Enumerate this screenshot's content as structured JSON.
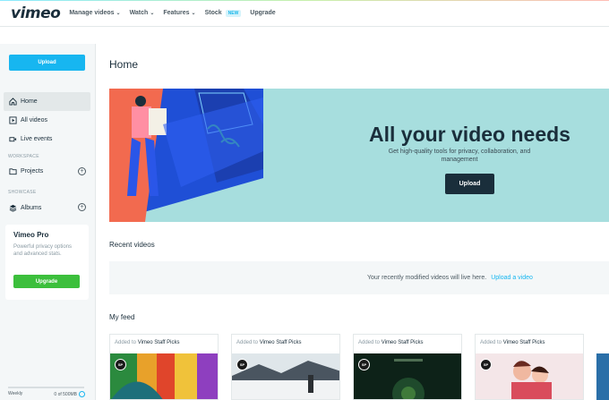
{
  "nav": {
    "logo": "vimeo",
    "items": [
      {
        "label": "Manage videos",
        "has_caret": true
      },
      {
        "label": "Watch",
        "has_caret": true
      },
      {
        "label": "Features",
        "has_caret": true
      },
      {
        "label": "Stock",
        "badge": "NEW"
      },
      {
        "label": "Upgrade"
      }
    ]
  },
  "sidebar": {
    "upload_label": "Upload",
    "items": [
      {
        "label": "Home",
        "icon": "home-icon"
      },
      {
        "label": "All videos",
        "icon": "video-library-icon"
      },
      {
        "label": "Live events",
        "icon": "camera-icon"
      },
      {
        "label": "Projects",
        "icon": "folder-icon"
      },
      {
        "label": "Albums",
        "icon": "stack-icon"
      }
    ],
    "workspace_label": "WORKSPACE",
    "showcase_label": "SHOWCASE",
    "pro": {
      "title": "Vimeo Pro",
      "description": "Powerful privacy options and advanced stats.",
      "button": "Upgrade"
    },
    "storage": {
      "period": "Weekly",
      "used": "0 of 500MB",
      "fraction": 0
    }
  },
  "main": {
    "title": "Home",
    "hero": {
      "title": "All your video needs",
      "subtitle": "Get high-quality tools for privacy, collaboration, and management",
      "button": "Upload"
    },
    "recent": {
      "title": "Recent videos",
      "empty_text": "Your recently modified videos will live here.",
      "link": "Upload a video"
    },
    "feed": {
      "title": "My feed",
      "added_prefix": "Added to",
      "channel": "Vimeo Staff Picks",
      "badge": "SP",
      "cards": [
        {
          "thumb": "colorful-abstract"
        },
        {
          "thumb": "snowy-mountain"
        },
        {
          "thumb": "dark-green-title"
        },
        {
          "thumb": "illustrated-couple"
        }
      ]
    }
  },
  "colors": {
    "accent": "#17b6f0",
    "upgrade": "#3cbf3c",
    "hero_bg": "#a7dede",
    "dark": "#1a2e3b"
  }
}
